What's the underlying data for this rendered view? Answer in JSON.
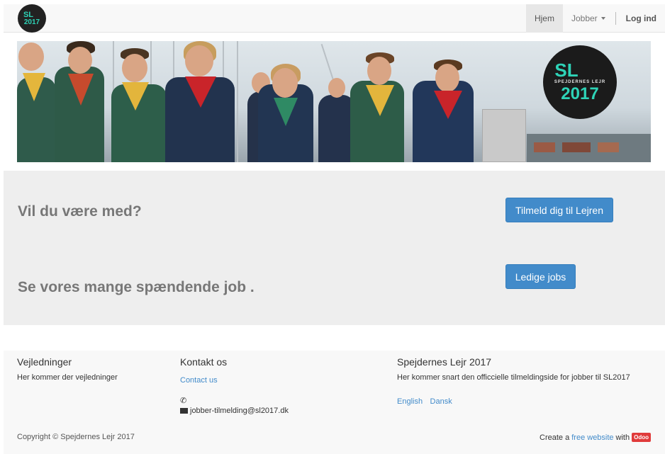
{
  "navbar": {
    "logo": {
      "line1": "SL",
      "line2": "2017"
    },
    "items": [
      {
        "label": "Hjem",
        "active": true
      },
      {
        "label": "Jobber",
        "dropdown": true
      },
      {
        "label": "Log ind"
      }
    ]
  },
  "banner": {
    "badge": {
      "sl": "SL",
      "middle": "SPEJDERNES LEJR",
      "year": "2017"
    }
  },
  "cta": {
    "heading1": "Vil du være med?",
    "button1": "Tilmeld dig til Lejren",
    "heading2": "Se vores mange spændende job .",
    "button2": "Ledige jobs"
  },
  "footer": {
    "col1": {
      "title": "Vejledninger",
      "text": "Her kommer der vejledninger"
    },
    "col2": {
      "title": "Kontakt os",
      "link": "Contact us",
      "email": "jobber-tilmelding@sl2017.dk"
    },
    "col3": {
      "title": "Spejdernes Lejr 2017",
      "text": "Her kommer snart den officcielle tilmeldingside for jobber til SL2017",
      "languages": [
        "English",
        "Dansk"
      ]
    },
    "copyright": "Copyright © Spejdernes Lejr 2017",
    "powered": {
      "prefix": "Create a",
      "link": "free website",
      "mid": "with",
      "badge": "Odoo"
    }
  },
  "colors": {
    "primary": "#428bca",
    "accent": "#2ed3b7",
    "odoo": "#e03b3b"
  }
}
